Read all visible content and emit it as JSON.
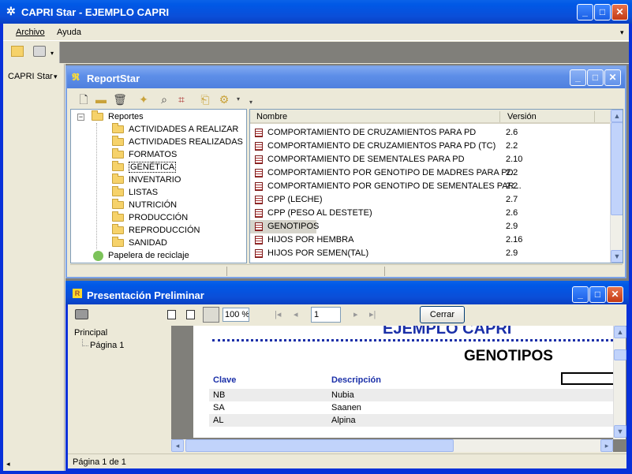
{
  "app": {
    "title": "CAPRI Star - EJEMPLO CAPRI",
    "min": "_",
    "max": "□",
    "close": "✕"
  },
  "menu": {
    "archivo": "Archivo",
    "ayuda": "Ayuda",
    "chevron": "▾"
  },
  "left_panel": {
    "label": "CAPRI Star",
    "arrow": "▾",
    "bottom_arrow": "◂"
  },
  "reportstar": {
    "title": "ReportStar",
    "tree": {
      "root": "Reportes",
      "items": [
        "ACTIVIDADES A REALIZAR",
        "ACTIVIDADES REALIZADAS",
        "FORMATOS",
        "GENÉTICA",
        "INVENTARIO",
        "LISTAS",
        "NUTRICIÓN",
        "PRODUCCIÓN",
        "REPRODUCCIÓN",
        "SANIDAD"
      ],
      "selected": "GENÉTICA",
      "recycle": "Papelera de reciclaje"
    },
    "list": {
      "col_name": "Nombre",
      "col_version": "Versión",
      "rows": [
        {
          "name": "COMPORTAMIENTO DE CRUZAMIENTOS PARA PD",
          "version": "2.6"
        },
        {
          "name": "COMPORTAMIENTO DE CRUZAMIENTOS PARA PD (TC)",
          "version": "2.2"
        },
        {
          "name": "COMPORTAMIENTO DE SEMENTALES PARA PD",
          "version": "2.10"
        },
        {
          "name": "COMPORTAMIENTO POR GENOTIPO DE MADRES PARA PD",
          "version": "2.2"
        },
        {
          "name": "COMPORTAMIENTO POR GENOTIPO DE SEMENTALES PAR...",
          "version": "2.2"
        },
        {
          "name": "CPP (LECHE)",
          "version": "2.7"
        },
        {
          "name": "CPP (PESO AL DESTETE)",
          "version": "2.6"
        },
        {
          "name": "GENOTIPOS",
          "version": "2.9"
        },
        {
          "name": "HIJOS POR HEMBRA",
          "version": "2.16"
        },
        {
          "name": "HIJOS POR SEMEN(TAL)",
          "version": "2.9"
        }
      ]
    }
  },
  "preview": {
    "title": "Presentación Preliminar",
    "zoom": "100 %",
    "page_input": "1",
    "close_button": "Cerrar",
    "outline": {
      "root": "Principal",
      "child": "Página 1"
    },
    "doc": {
      "header": "EJEMPLO CAPRI",
      "title": "GENOTIPOS",
      "col_clave": "Clave",
      "col_desc": "Descripción",
      "rows": [
        {
          "clave": "NB",
          "desc": "Nubia"
        },
        {
          "clave": "SA",
          "desc": "Saanen"
        },
        {
          "clave": "AL",
          "desc": "Alpina"
        }
      ]
    },
    "status": "Página 1 de 1"
  },
  "colors": {
    "titlebar": "#0058e6",
    "doc_blue": "#1a2fa8",
    "selection": "#d6d4cb"
  }
}
